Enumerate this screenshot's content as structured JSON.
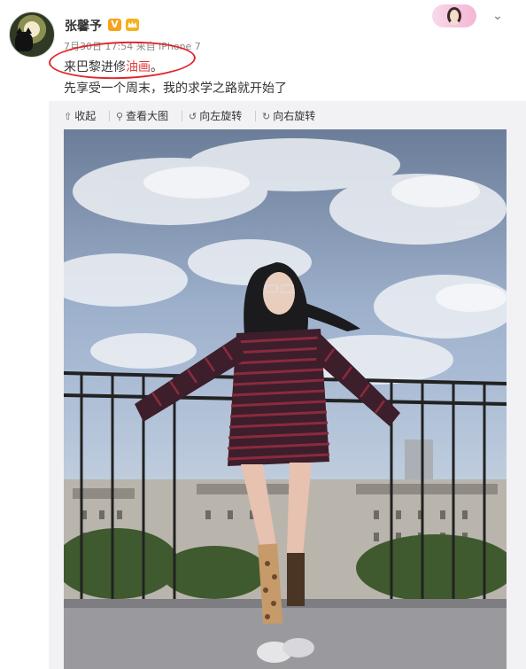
{
  "user": {
    "name": "张馨予",
    "verified_badge": "V"
  },
  "post": {
    "meta": "7月30日 17:54 来自 iPhone 7",
    "text_line1_prefix": "来巴黎进修",
    "text_line1_highlight": "油画",
    "text_line1_suffix": "。",
    "text_line2": "先享受一个周末，我的求学之路就开始了"
  },
  "toolbar": {
    "collapse": "收起",
    "view_large": "查看大图",
    "rotate_left": "向左旋转",
    "rotate_right": "向右旋转",
    "collapse_icon": "collapse-arrow-icon",
    "view_large_icon": "magnifier-icon",
    "rotate_left_icon": "rotate-left-icon",
    "rotate_right_icon": "rotate-right-icon"
  },
  "colors": {
    "highlight": "#e4393c",
    "annotation_circle": "#e0262a",
    "verified": "#f7a21b"
  }
}
